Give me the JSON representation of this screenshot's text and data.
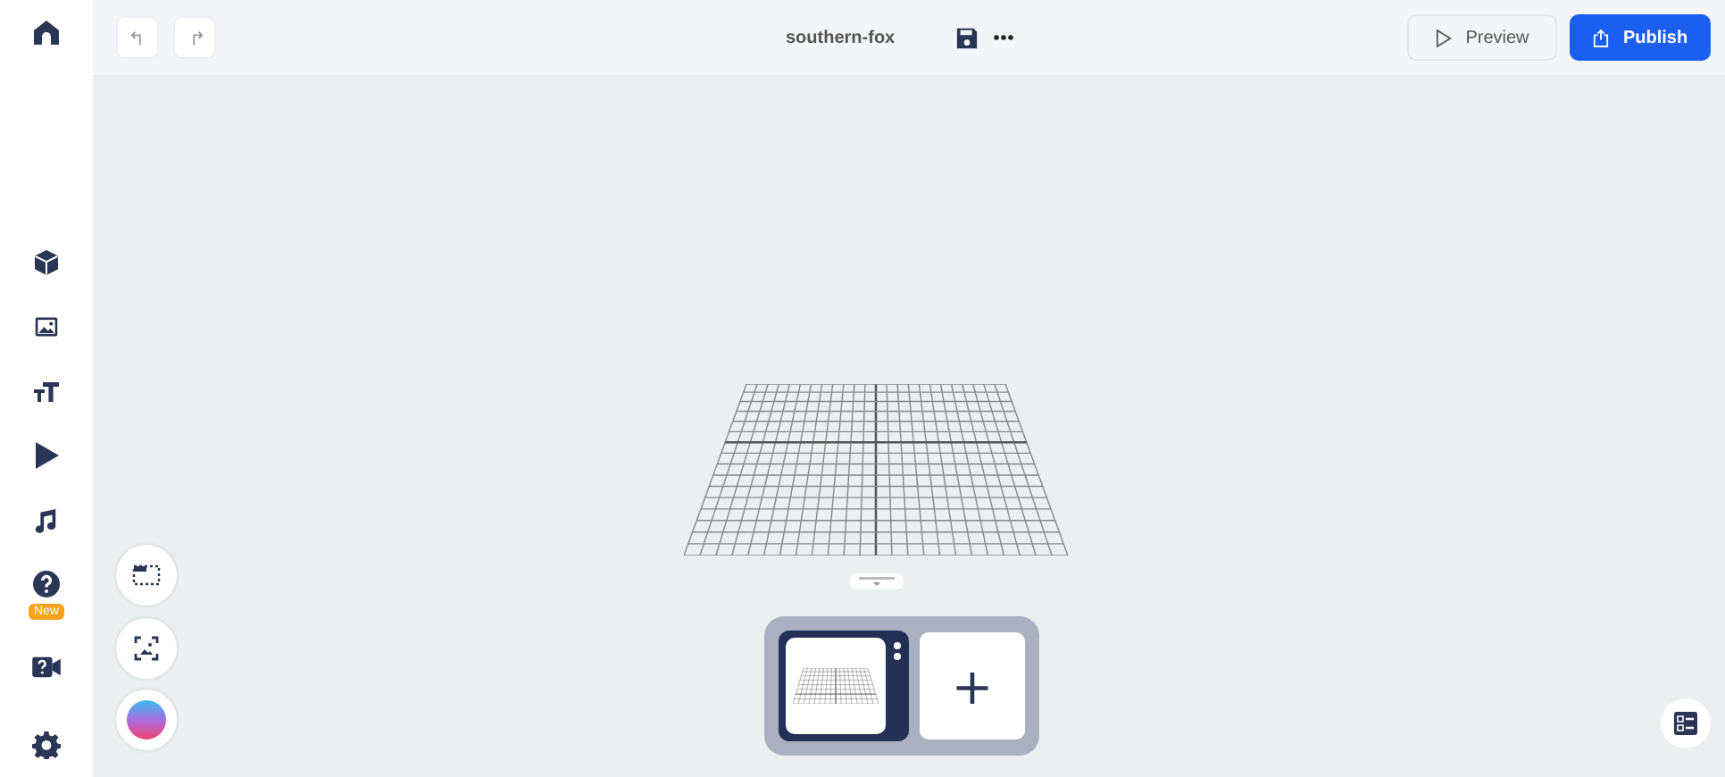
{
  "sidebar": {
    "items": [
      {
        "kind": "home"
      },
      {
        "kind": "cube"
      },
      {
        "kind": "image"
      },
      {
        "kind": "text"
      },
      {
        "kind": "play"
      },
      {
        "kind": "music"
      },
      {
        "kind": "help",
        "badge": "New"
      },
      {
        "kind": "camera"
      },
      {
        "kind": "gear"
      }
    ]
  },
  "topbar": {
    "title": "southern-fox",
    "preview": "Preview",
    "publish": "Publish"
  },
  "scenes": {
    "add": "+"
  }
}
